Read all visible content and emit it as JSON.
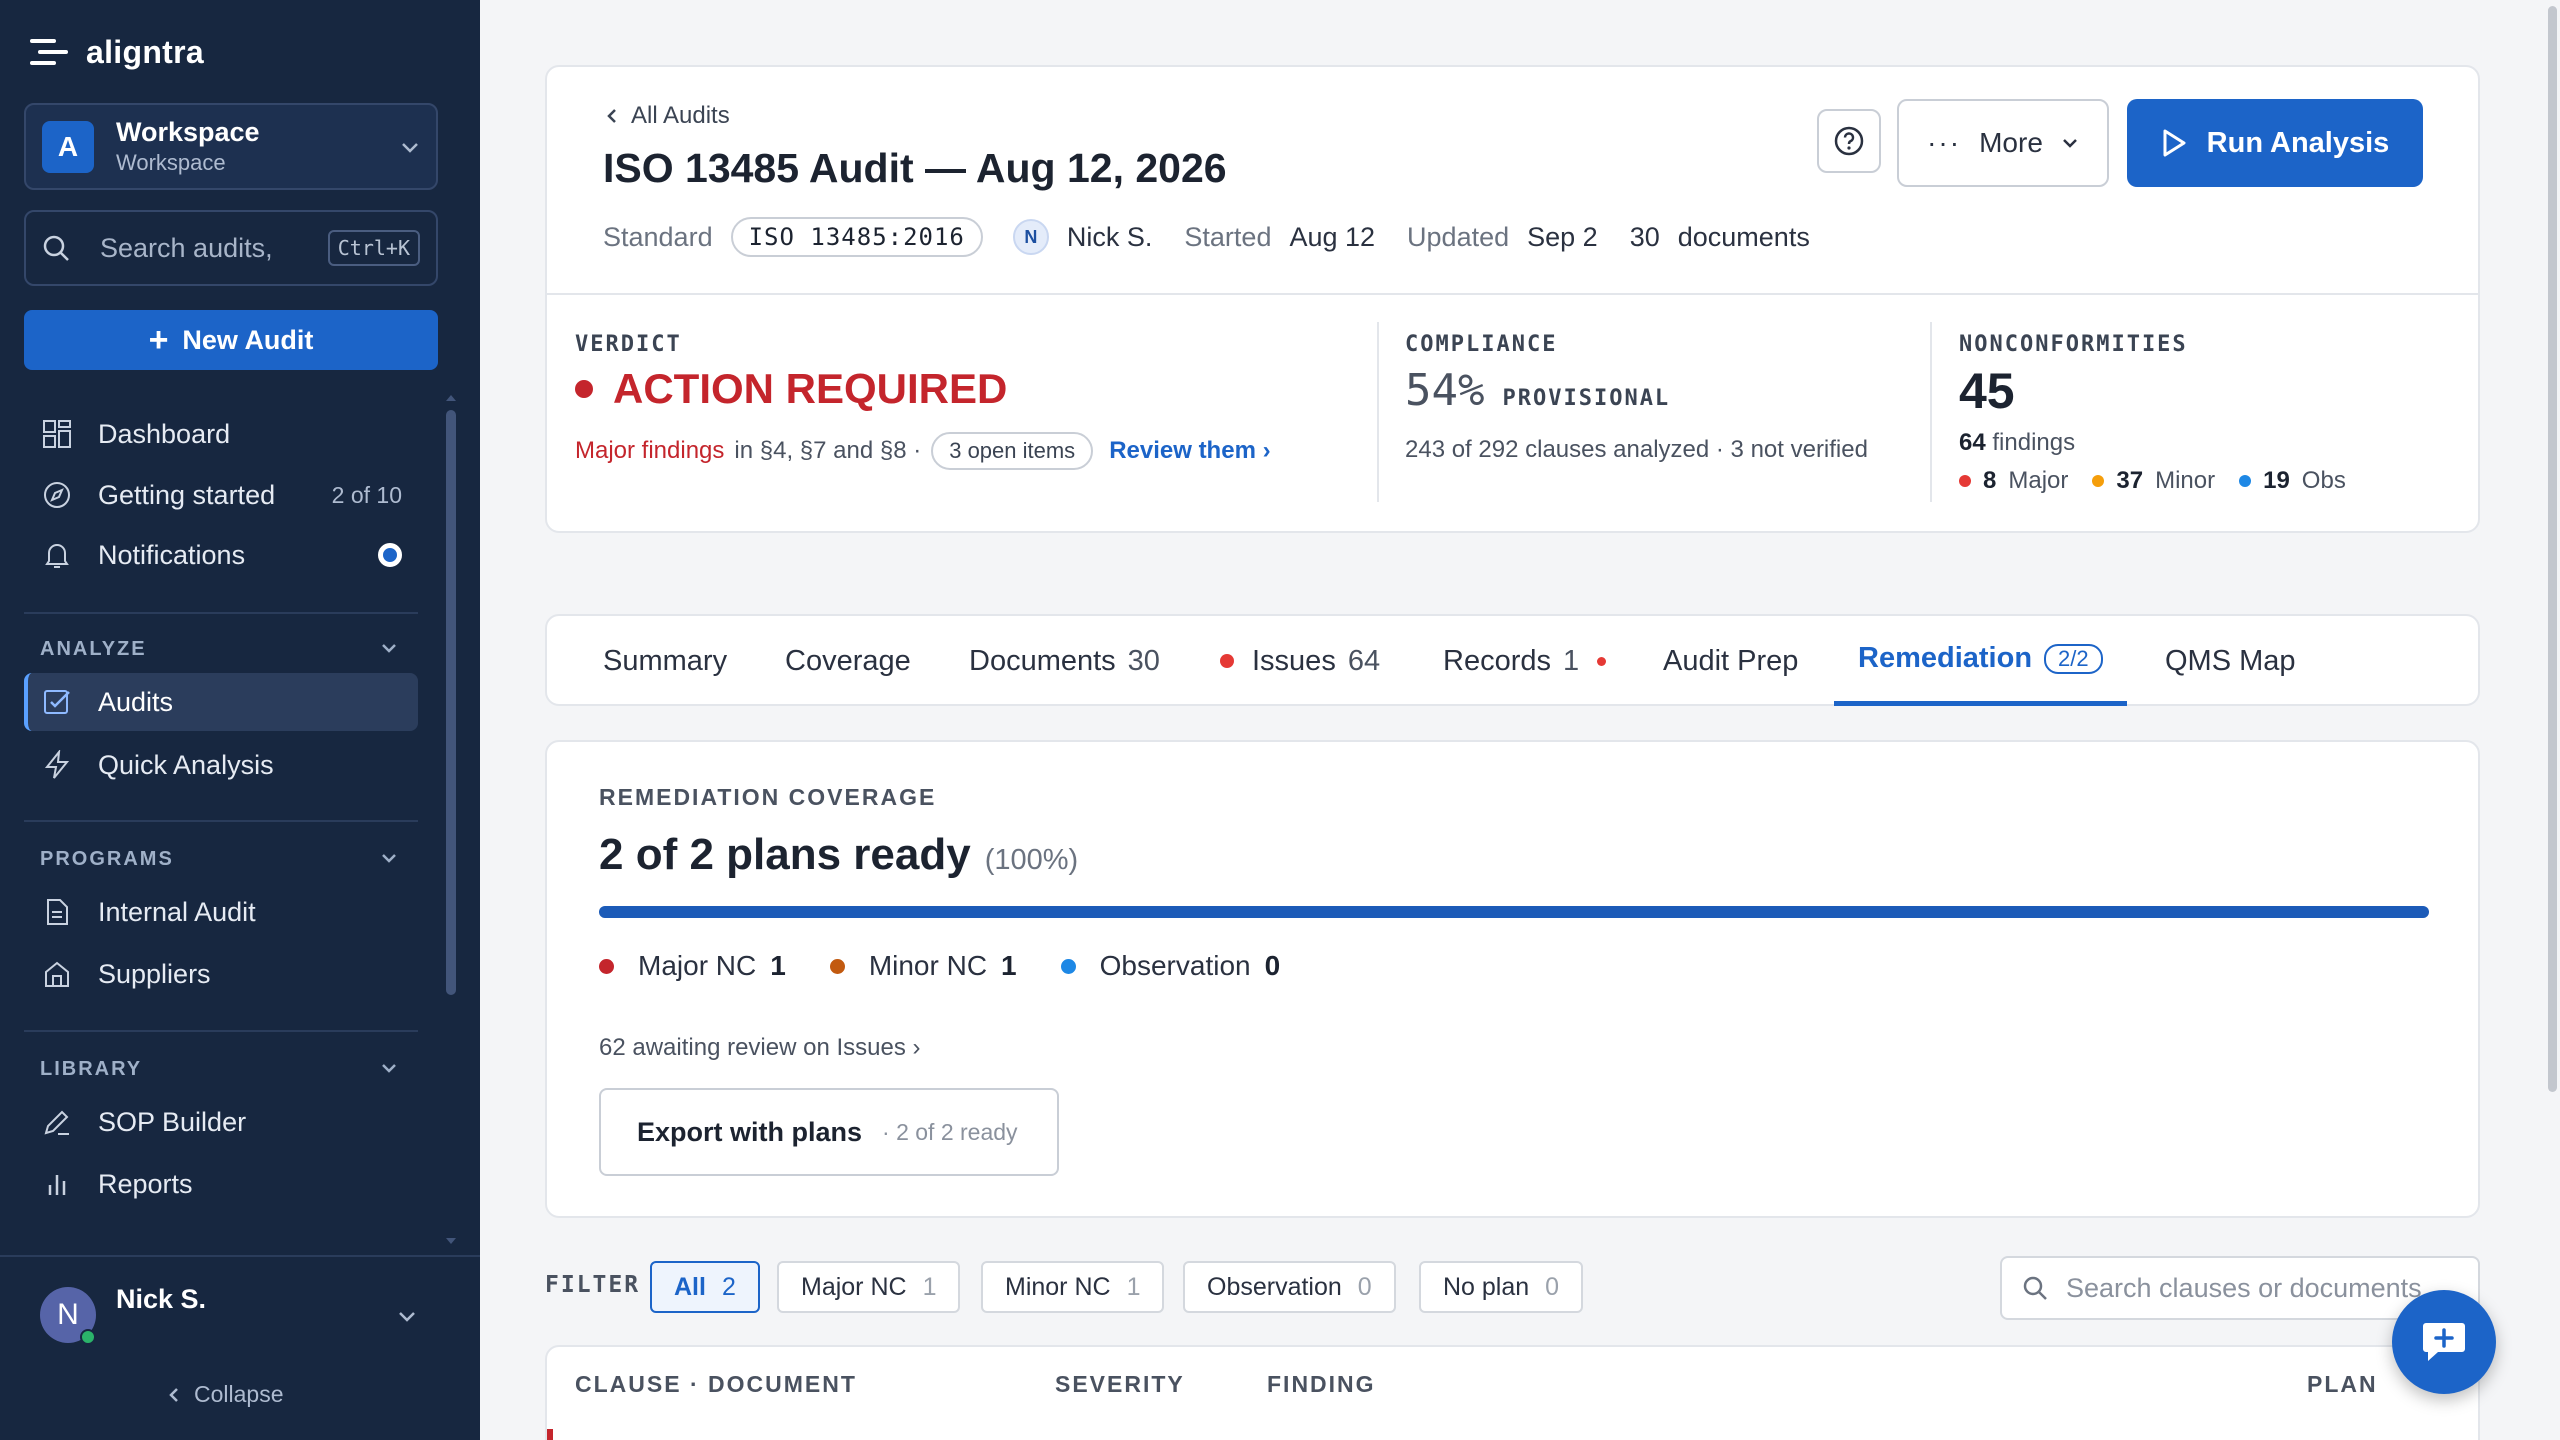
{
  "app": {
    "brand": "aligntra"
  },
  "workspace": {
    "avatar": "A",
    "name": "Workspace",
    "sub": "Workspace"
  },
  "search": {
    "placeholder": "Search audits,",
    "shortcut": "Ctrl+K"
  },
  "new_audit": {
    "label": "New Audit"
  },
  "nav": {
    "dashboard": "Dashboard",
    "getting_started": "Getting started",
    "getting_started_progress": "2 of 10",
    "notifications": "Notifications"
  },
  "sections": {
    "analyze": {
      "label": "ANALYZE",
      "items": [
        "Audits",
        "Quick Analysis"
      ]
    },
    "programs": {
      "label": "PROGRAMS",
      "items": [
        "Internal Audit",
        "Suppliers"
      ]
    },
    "library": {
      "label": "LIBRARY",
      "items": [
        "SOP Builder",
        "Reports"
      ]
    }
  },
  "user": {
    "initial": "N",
    "name": "Nick S."
  },
  "collapse": "Collapse",
  "header": {
    "back": "All Audits",
    "title": "ISO 13485 Audit — Aug 12, 2026",
    "standard_label": "Standard",
    "standard": "ISO 13485:2016",
    "owner_initial": "N",
    "owner": "Nick S.",
    "started_label": "Started",
    "started": "Aug 12",
    "updated_label": "Updated",
    "updated": "Sep 2",
    "documents_count": "30",
    "documents_label": "documents",
    "more": "More",
    "run": "Run Analysis"
  },
  "verdict": {
    "label": "VERDICT",
    "value": "ACTION REQUIRED",
    "major": "Major findings",
    "in_clauses": "in §4, §7 and §8 ·",
    "open_items": "3 open items",
    "review": "Review them ›"
  },
  "compliance": {
    "label": "COMPLIANCE",
    "value": "54%",
    "status": "PROVISIONAL",
    "detail": "243 of 292 clauses analyzed · 3 not verified"
  },
  "nonconformities": {
    "label": "NONCONFORMITIES",
    "value": "45",
    "findings_count": "64",
    "findings_label": "findings",
    "major_count": "8",
    "major_label": "Major",
    "minor_count": "37",
    "minor_label": "Minor",
    "obs_count": "19",
    "obs_label": "Obs"
  },
  "tabs": [
    {
      "label": "Summary"
    },
    {
      "label": "Coverage"
    },
    {
      "label": "Documents",
      "count": "30"
    },
    {
      "label": "Issues",
      "count": "64"
    },
    {
      "label": "Records",
      "count": "1"
    },
    {
      "label": "Audit Prep"
    },
    {
      "label": "Remediation",
      "badge": "2/2"
    },
    {
      "label": "QMS Map"
    }
  ],
  "remediation": {
    "label": "REMEDIATION COVERAGE",
    "title": "2 of 2 plans ready",
    "percent_text": "(100%)",
    "progress": 1.0,
    "legend": [
      {
        "label": "Major NC",
        "count": "1",
        "color": "#c4252c"
      },
      {
        "label": "Minor NC",
        "count": "1",
        "color": "#c25a10"
      },
      {
        "label": "Observation",
        "count": "0",
        "color": "#1e88e5"
      }
    ],
    "awaiting": "62 awaiting review on Issues ›",
    "export_label": "Export with plans",
    "export_sub": "· 2 of 2 ready"
  },
  "filter": {
    "label": "FILTER",
    "chips": [
      {
        "label": "All",
        "count": "2"
      },
      {
        "label": "Major NC",
        "count": "1"
      },
      {
        "label": "Minor NC",
        "count": "1"
      },
      {
        "label": "Observation",
        "count": "0"
      },
      {
        "label": "No plan",
        "count": "0"
      }
    ],
    "search_placeholder": "Search clauses or documents"
  },
  "table": {
    "headers": [
      "CLAUSE · DOCUMENT",
      "SEVERITY",
      "FINDING",
      "PLAN"
    ]
  },
  "colors": {
    "accent": "#1c64c8",
    "sidebar": "#172740",
    "danger": "#c4252c"
  }
}
